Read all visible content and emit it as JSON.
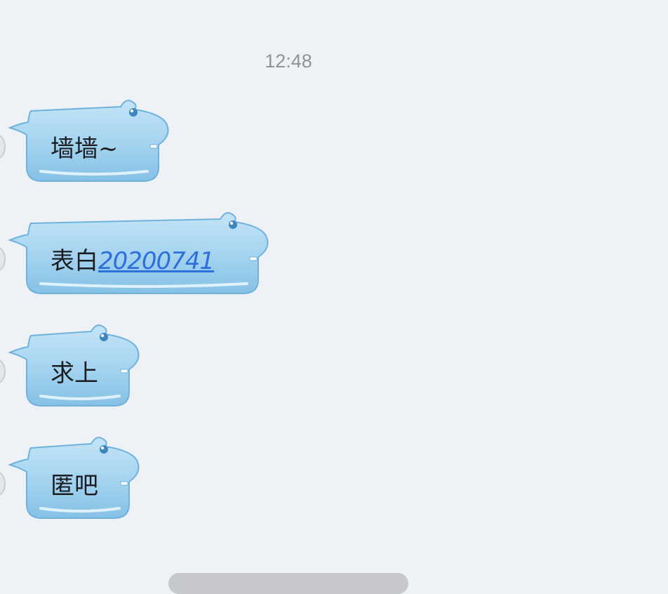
{
  "chat": {
    "timestamp": "12:48",
    "messages": [
      {
        "text": "墙墙~",
        "link": ""
      },
      {
        "text": "表白",
        "link": "20200741"
      },
      {
        "text": "求上",
        "link": ""
      },
      {
        "text": "匿吧",
        "link": ""
      }
    ]
  },
  "colors": {
    "background": "#eef1f5",
    "bubble_fill": "#a3d3ef",
    "bubble_stroke": "#6fb3dc",
    "link": "#2f6fdc",
    "timestamp": "#8f9398"
  },
  "icons": {
    "bubble_decoration": "hippo-ear-eye-icon"
  }
}
